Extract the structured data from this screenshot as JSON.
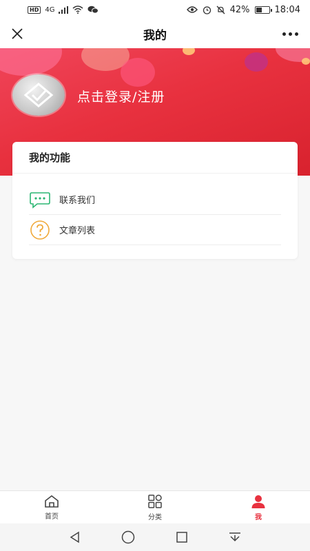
{
  "status_bar": {
    "left_badge": "HD",
    "network": "4G",
    "battery": "42%",
    "time": "18:04"
  },
  "nav": {
    "title": "我的"
  },
  "profile": {
    "login_text": "点击登录/注册"
  },
  "functions": {
    "title": "我的功能",
    "items": [
      {
        "label": "联系我们",
        "icon": "chat-bubble-icon",
        "color": "#2bb673"
      },
      {
        "label": "文章列表",
        "icon": "question-circle-icon",
        "color": "#f0a93a"
      }
    ]
  },
  "tabs": [
    {
      "label": "首页",
      "icon": "home-icon",
      "active": false
    },
    {
      "label": "分类",
      "icon": "category-grid-icon",
      "active": false
    },
    {
      "label": "我",
      "icon": "user-icon",
      "active": true
    }
  ],
  "colors": {
    "accent": "#e8313f"
  }
}
